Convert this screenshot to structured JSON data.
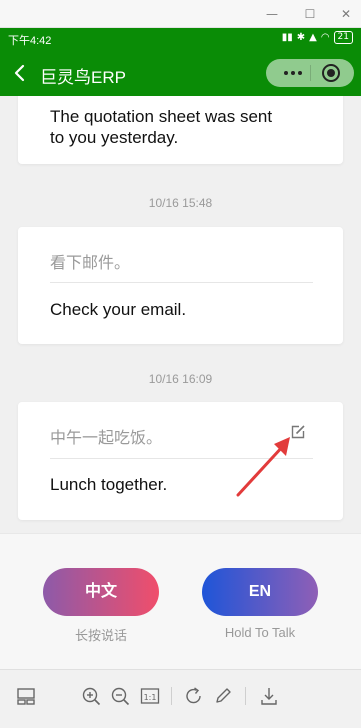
{
  "status_bar": {
    "time": "下午4:42",
    "battery": "21"
  },
  "nav": {
    "title": "巨灵鸟ERP"
  },
  "chat": {
    "messages": [
      {
        "translation": "The quotation sheet was sent to you yesterday."
      },
      {
        "timestamp": "10/16 15:48",
        "source": "看下邮件。",
        "translation": "Check your email."
      },
      {
        "timestamp": "10/16 16:09",
        "source": "中午一起吃饭。",
        "translation": "Lunch together."
      }
    ]
  },
  "voice": {
    "chinese_button": "中文",
    "chinese_hint": "长按说话",
    "english_button": "EN",
    "english_hint": "Hold To Talk"
  },
  "colors": {
    "nav_green": "#0a8c06",
    "arrow_red": "#e23b3b"
  }
}
